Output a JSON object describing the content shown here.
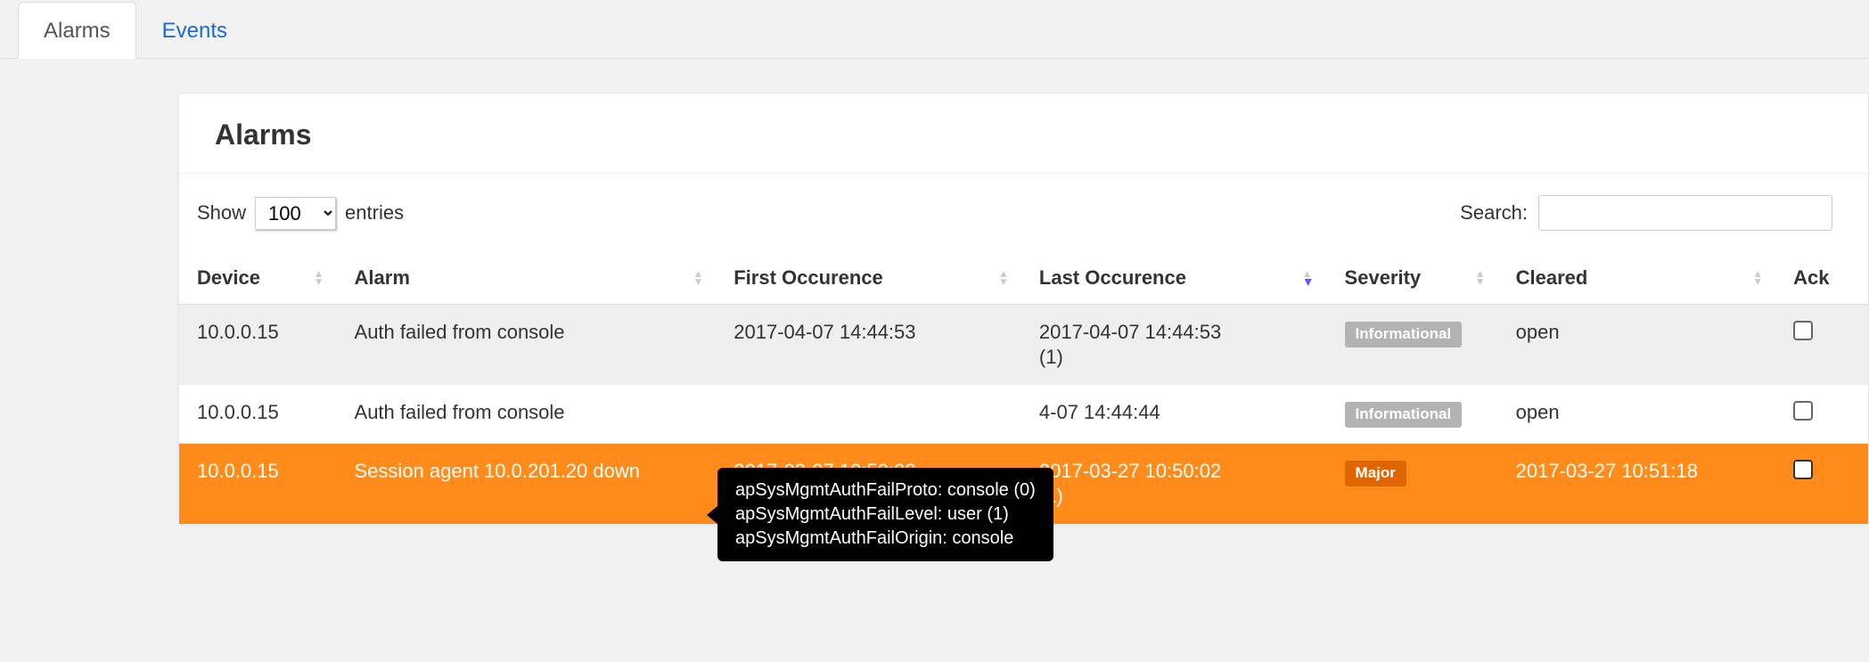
{
  "tabs": {
    "alarms": "Alarms",
    "events": "Events"
  },
  "panel": {
    "title": "Alarms"
  },
  "toolbar": {
    "show_label_pre": "Show",
    "show_label_post": "entries",
    "show_value": "100",
    "search_label": "Search:"
  },
  "columns": {
    "device": "Device",
    "alarm": "Alarm",
    "first": "First Occurence",
    "last": "Last Occurence",
    "severity": "Severity",
    "cleared": "Cleared",
    "ack": "Ack"
  },
  "rows": [
    {
      "device": "10.0.0.15",
      "alarm": "Auth failed from console",
      "first": "2017-04-07 14:44:53",
      "last": "2017-04-07 14:44:53",
      "last_count": "(1)",
      "severity_label": "Informational",
      "severity_class": "informational",
      "cleared": "open",
      "row_class": "shaded"
    },
    {
      "device": "10.0.0.15",
      "alarm": "Auth failed from console",
      "first": "",
      "last": "4-07 14:44:44",
      "last_count": "",
      "severity_label": "Informational",
      "severity_class": "informational",
      "cleared": "open",
      "row_class": "normal"
    },
    {
      "device": "10.0.0.15",
      "alarm": "Session agent 10.0.201.20 down",
      "first": "2017-03-27 10:50:02",
      "last": "2017-03-27 10:50:02",
      "last_count": "(1)",
      "severity_label": "Major",
      "severity_class": "major",
      "cleared": "2017-03-27 10:51:18",
      "row_class": "major"
    }
  ],
  "tooltip": {
    "line1": "apSysMgmtAuthFailProto: console (0)",
    "line2": "apSysMgmtAuthFailLevel: user (1)",
    "line3": "apSysMgmtAuthFailOrigin: console"
  }
}
